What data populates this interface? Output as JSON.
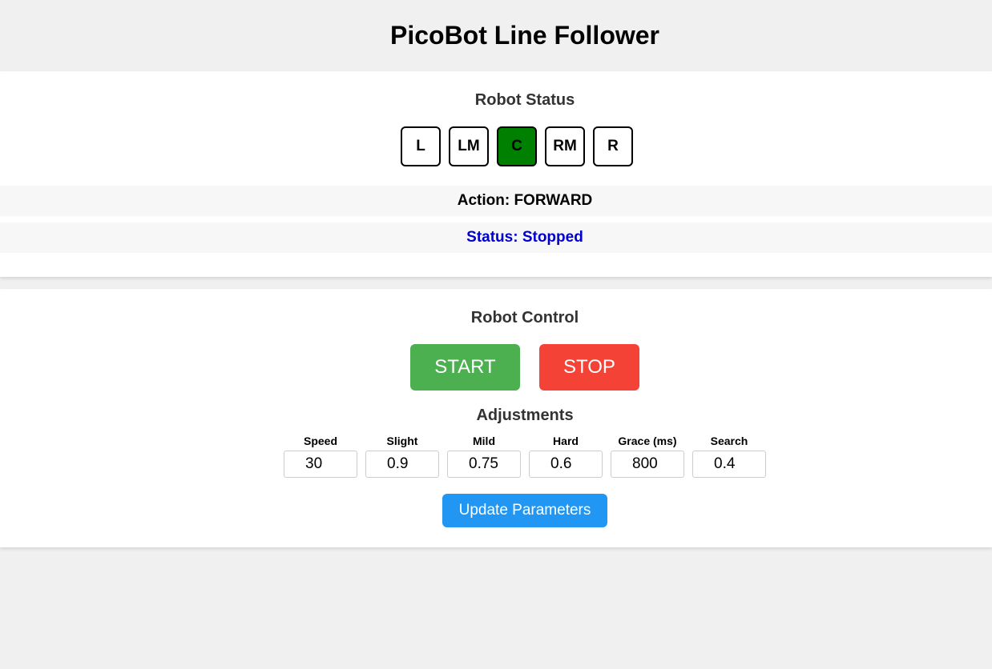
{
  "page": {
    "title": "PicoBot Line Follower"
  },
  "status_section": {
    "heading": "Robot Status",
    "sensors": [
      {
        "label": "L",
        "active": false
      },
      {
        "label": "LM",
        "active": false
      },
      {
        "label": "C",
        "active": true
      },
      {
        "label": "RM",
        "active": false
      },
      {
        "label": "R",
        "active": false
      }
    ],
    "action_text": "Action: FORWARD",
    "status_text": "Status: Stopped",
    "colors": {
      "sensor_active": "#008000",
      "status_text": "#0000cc"
    }
  },
  "control_section": {
    "heading": "Robot Control",
    "start_label": "START",
    "stop_label": "STOP",
    "adjustments_heading": "Adjustments",
    "params": [
      {
        "label": "Speed",
        "value": "30"
      },
      {
        "label": "Slight",
        "value": "0.9"
      },
      {
        "label": "Mild",
        "value": "0.75"
      },
      {
        "label": "Hard",
        "value": "0.6"
      },
      {
        "label": "Grace (ms)",
        "value": "800"
      },
      {
        "label": "Search",
        "value": "0.4"
      }
    ],
    "update_label": "Update Parameters",
    "colors": {
      "start": "#4caf50",
      "stop": "#f44336",
      "update": "#2196f3"
    }
  }
}
